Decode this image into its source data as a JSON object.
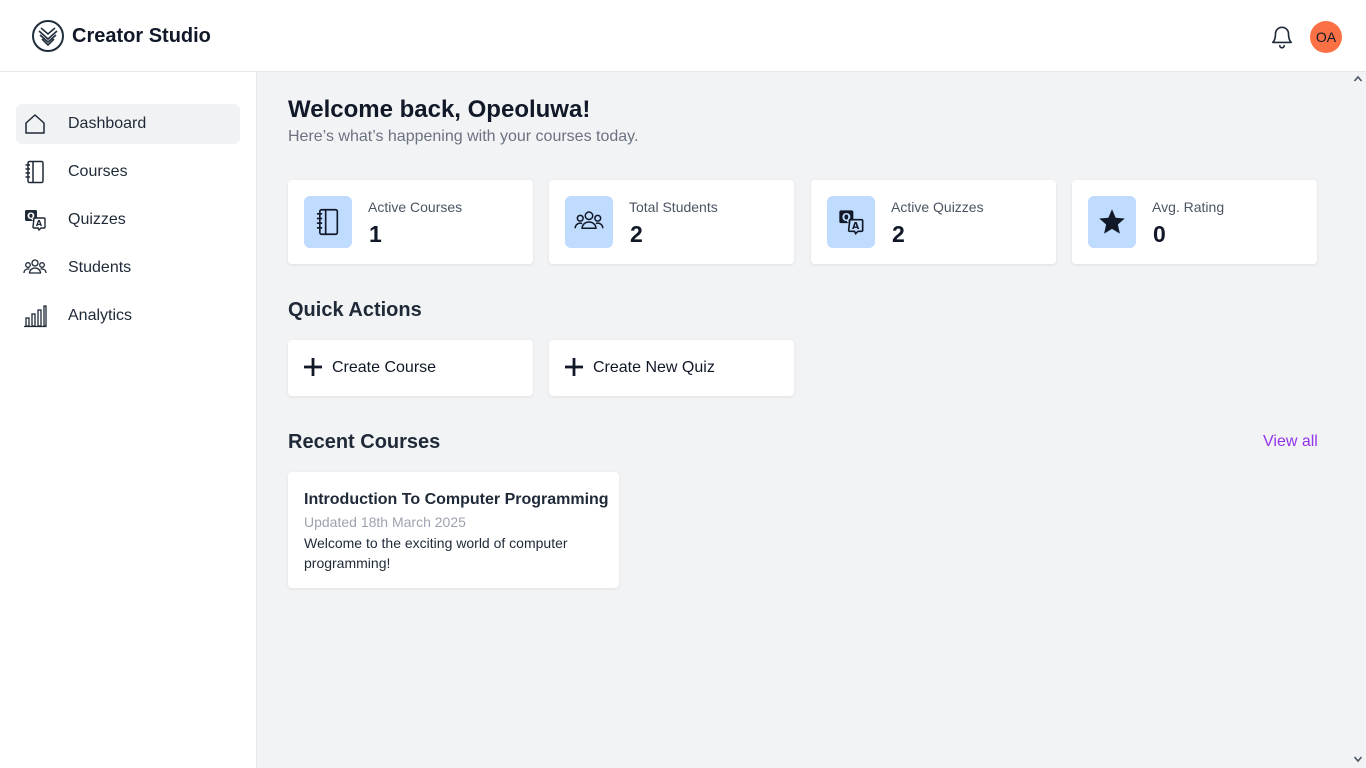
{
  "app": {
    "title": "Creator Studio",
    "logo_icon": "brand-logo-icon"
  },
  "header": {
    "notification_icon": "bell-icon",
    "avatar_initials": "OA",
    "avatar_color": "#fb7145"
  },
  "sidebar": {
    "items": [
      {
        "label": "Dashboard",
        "icon": "home-icon",
        "active": true
      },
      {
        "label": "Courses",
        "icon": "notebook-icon",
        "active": false
      },
      {
        "label": "Quizzes",
        "icon": "qa-icon",
        "active": false
      },
      {
        "label": "Students",
        "icon": "users-icon",
        "active": false
      },
      {
        "label": "Analytics",
        "icon": "bar-chart-icon",
        "active": false
      }
    ]
  },
  "main": {
    "welcome": "Welcome back, Opeoluwa!",
    "subtitle": "Here’s what’s happening with your courses today.",
    "stats": [
      {
        "label": "Active Courses",
        "value": "1",
        "icon": "notebook-icon"
      },
      {
        "label": "Total Students",
        "value": "2",
        "icon": "users-icon"
      },
      {
        "label": "Active Quizzes",
        "value": "2",
        "icon": "qa-icon"
      },
      {
        "label": "Avg. Rating",
        "value": "0",
        "icon": "star-icon"
      }
    ],
    "quick_actions": {
      "title": "Quick Actions",
      "items": [
        {
          "label": "Create Course",
          "icon": "plus-icon"
        },
        {
          "label": "Create New Quiz",
          "icon": "plus-icon"
        }
      ]
    },
    "recent_courses": {
      "title": "Recent Courses",
      "view_all": "View all",
      "items": [
        {
          "title": "Introduction To Computer Programming",
          "updated": "Updated 18th March 2025",
          "description": "Welcome to the exciting world of computer programming!"
        }
      ]
    }
  },
  "colors": {
    "accent_link": "#9333ea",
    "stat_icon_bg": "#bfdbfe",
    "page_bg": "#f2f3f5"
  }
}
